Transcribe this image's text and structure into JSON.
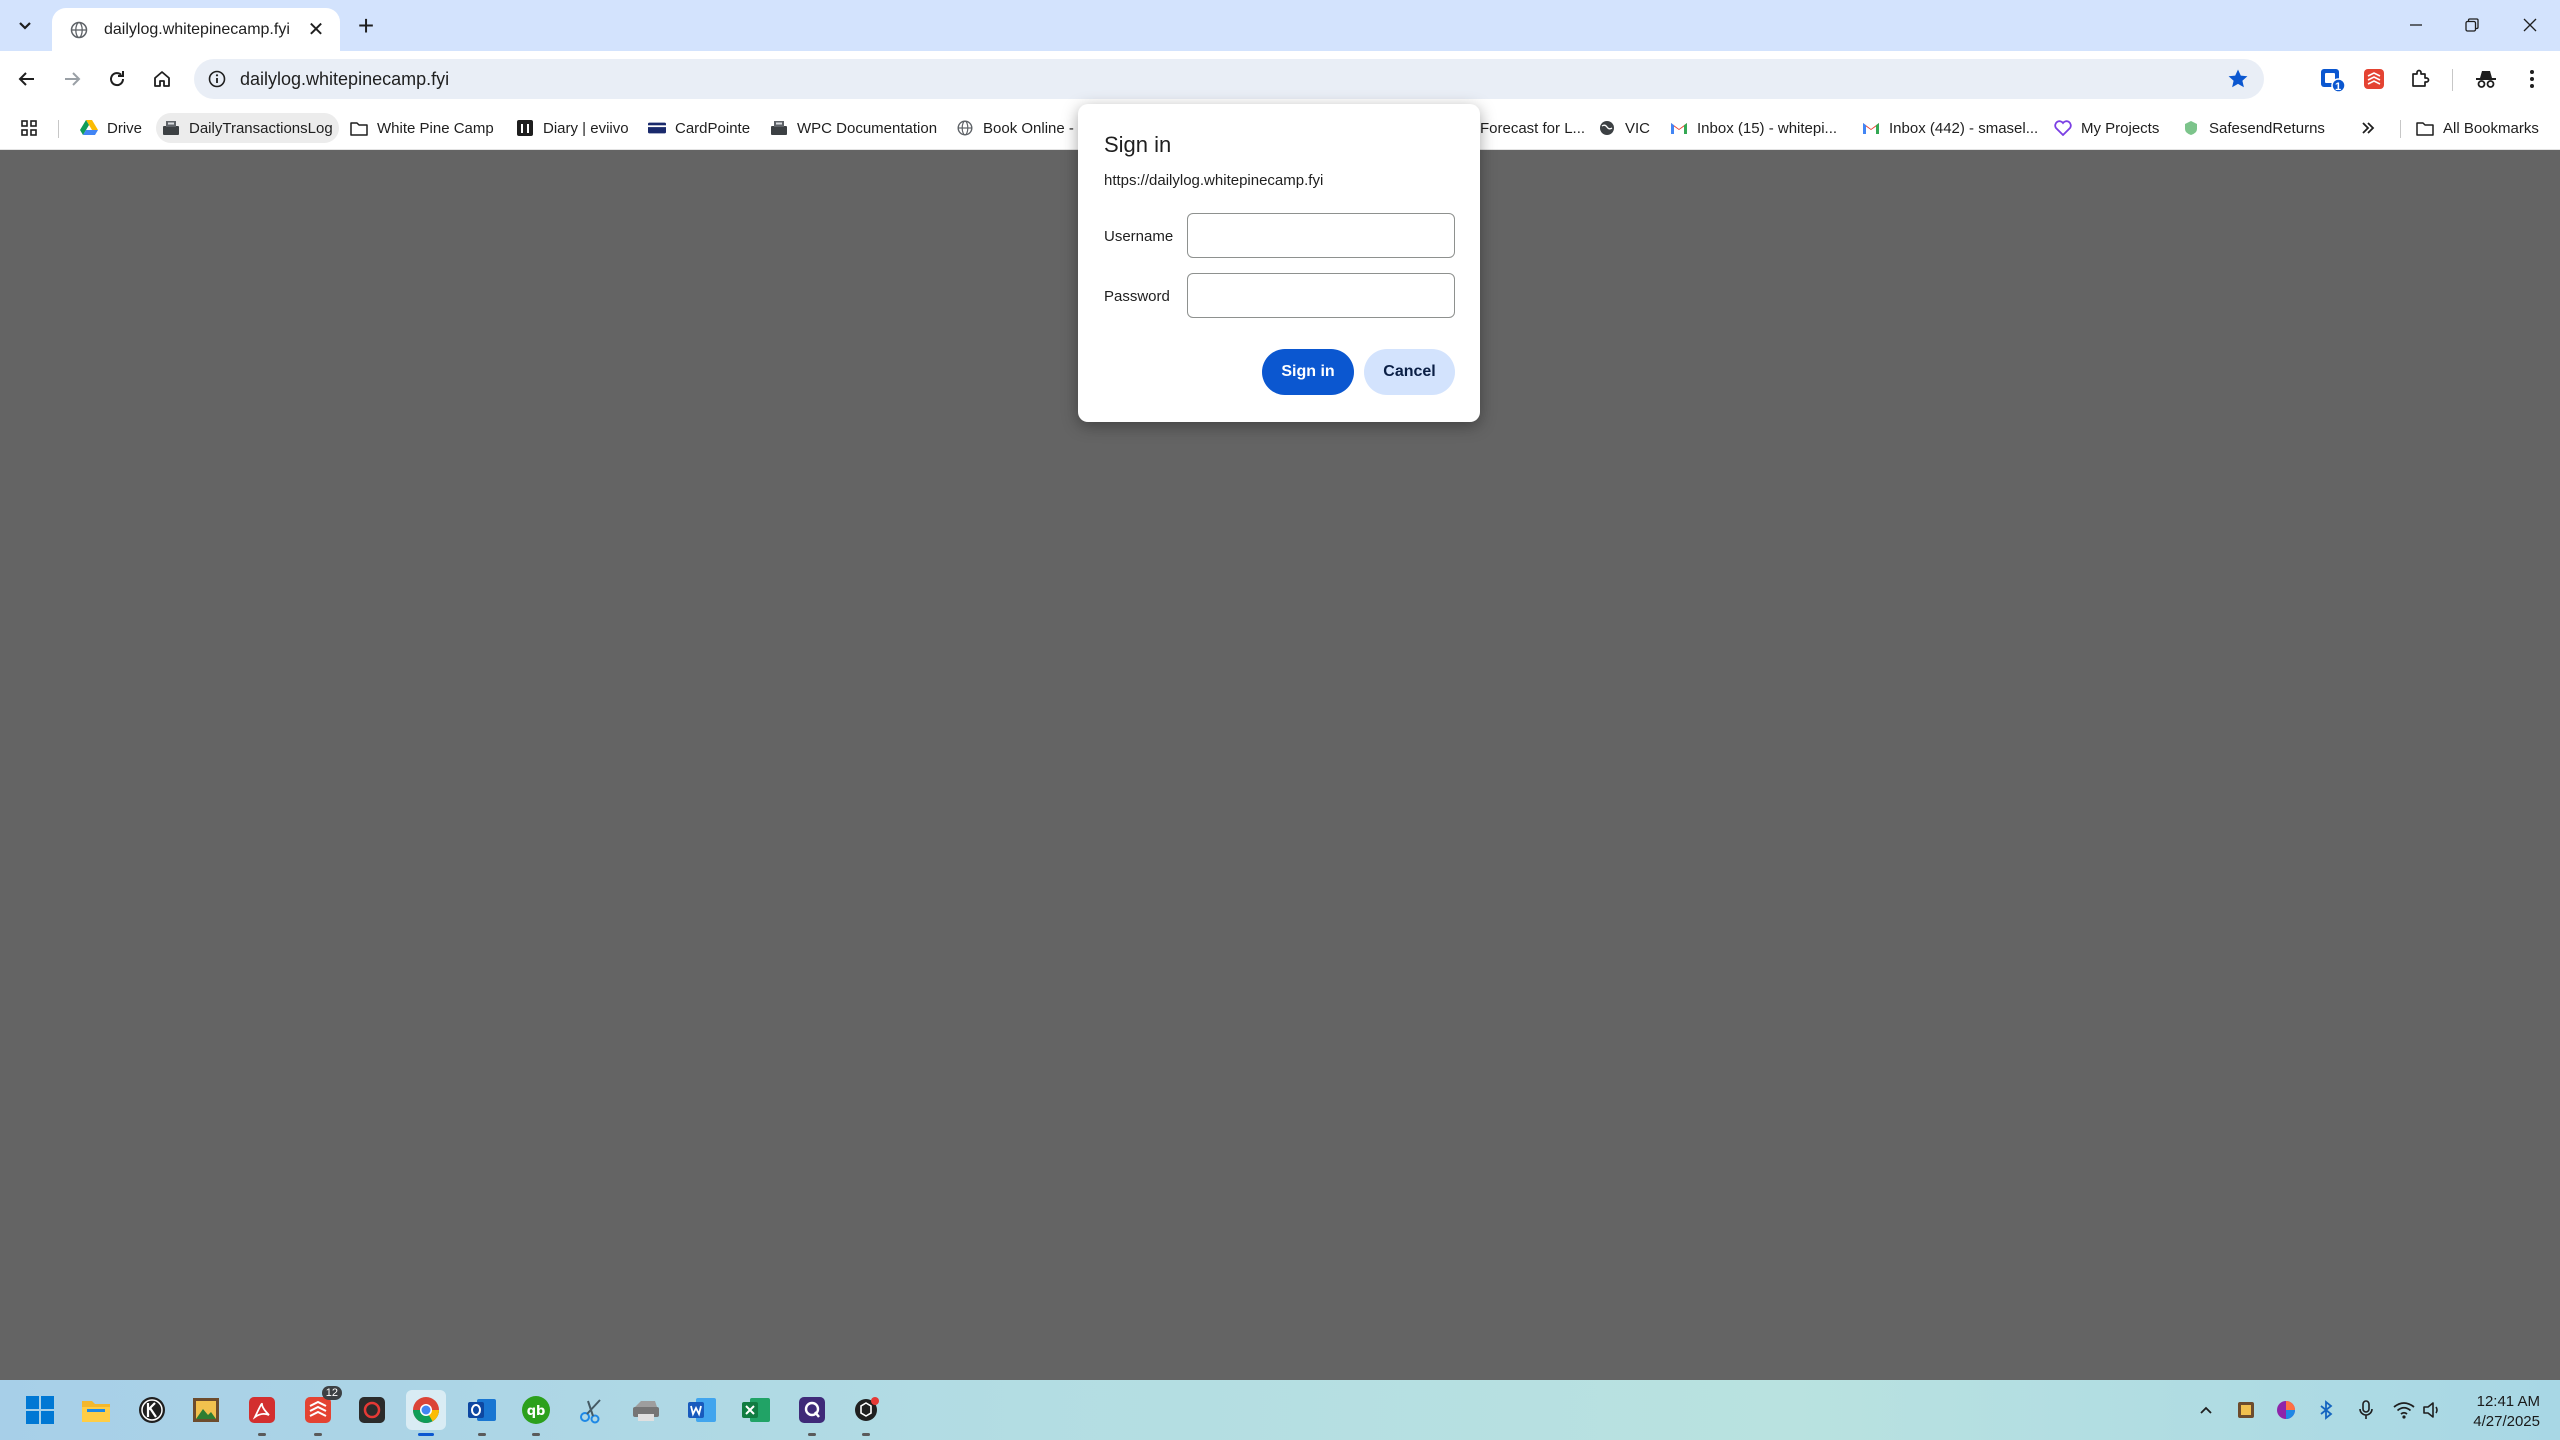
{
  "browser": {
    "tab": {
      "title": "dailylog.whitepinecamp.fyi",
      "favicon": "globe-icon"
    },
    "address_bar": {
      "url": "dailylog.whitepinecamp.fyi"
    },
    "extension_badge": "1"
  },
  "bookmarks": [
    {
      "label": "Drive",
      "icon": "google-drive-icon"
    },
    {
      "label": "DailyTransactionsLog",
      "icon": "register-icon"
    },
    {
      "label": "White Pine Camp",
      "icon": "folder-icon"
    },
    {
      "label": "Diary | eviivo",
      "icon": "eviivo-icon"
    },
    {
      "label": "CardPointe",
      "icon": "card-icon"
    },
    {
      "label": "WPC Documentation",
      "icon": "register-icon"
    },
    {
      "label": "Book Online -",
      "icon": "globe-icon"
    },
    {
      "label": "Forecast for L...",
      "icon": "weather-icon"
    },
    {
      "label": "VIC",
      "icon": "globe-icon"
    },
    {
      "label": "Inbox (15) - whitepi...",
      "icon": "gmail-icon"
    },
    {
      "label": "Inbox (442) - smasel...",
      "icon": "gmail-icon"
    },
    {
      "label": "My Projects",
      "icon": "heart-icon"
    },
    {
      "label": "SafesendReturns",
      "icon": "safesend-icon"
    }
  ],
  "all_bookmarks_label": "All Bookmarks",
  "dialog": {
    "title": "Sign in",
    "origin": "https://dailylog.whitepinecamp.fyi",
    "username_label": "Username",
    "password_label": "Password",
    "username_value": "",
    "password_value": "",
    "sign_in_label": "Sign in",
    "cancel_label": "Cancel"
  },
  "taskbar": {
    "badge_count": "12",
    "time": "12:41 AM",
    "date": "4/27/2025"
  },
  "colors": {
    "accent": "#0b57d0",
    "tabstrip": "#d3e3fd",
    "page_scrim": "#646464"
  }
}
